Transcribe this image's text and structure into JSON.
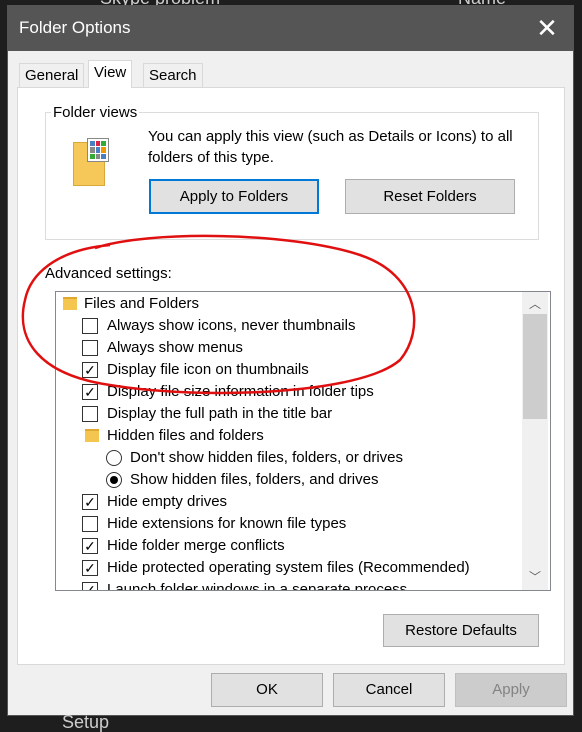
{
  "background": {
    "text1": "Skype problem",
    "text2": "Name",
    "text3": "Setup"
  },
  "dialog": {
    "title": "Folder Options",
    "close_icon": "close-icon"
  },
  "tabs": [
    {
      "label": "General"
    },
    {
      "label": "View",
      "active": true
    },
    {
      "label": "Search"
    }
  ],
  "folder_views": {
    "legend": "Folder views",
    "description": "You can apply this view (such as Details or Icons) to all folders of this type.",
    "apply_label": "Apply to Folders",
    "reset_label": "Reset Folders"
  },
  "advanced": {
    "label": "Advanced settings:",
    "items": [
      {
        "type": "folder",
        "label": "Files and Folders",
        "indent": 0
      },
      {
        "type": "checkbox",
        "label": "Always show icons, never thumbnails",
        "checked": false
      },
      {
        "type": "checkbox",
        "label": "Always show menus",
        "checked": false
      },
      {
        "type": "checkbox",
        "label": "Display file icon on thumbnails",
        "checked": true
      },
      {
        "type": "checkbox",
        "label": "Display file size information in folder tips",
        "checked": true
      },
      {
        "type": "checkbox",
        "label": "Display the full path in the title bar",
        "checked": false
      },
      {
        "type": "folder",
        "label": "Hidden files and folders",
        "indent": 1
      },
      {
        "type": "radio",
        "label": "Don't show hidden files, folders, or drives",
        "checked": false
      },
      {
        "type": "radio",
        "label": "Show hidden files, folders, and drives",
        "checked": true
      },
      {
        "type": "checkbox",
        "label": "Hide empty drives",
        "checked": true
      },
      {
        "type": "checkbox",
        "label": "Hide extensions for known file types",
        "checked": false
      },
      {
        "type": "checkbox",
        "label": "Hide folder merge conflicts",
        "checked": true
      },
      {
        "type": "checkbox",
        "label": "Hide protected operating system files (Recommended)",
        "checked": true
      },
      {
        "type": "checkbox",
        "label": "Launch folder windows in a separate process",
        "checked": true
      }
    ]
  },
  "restore_label": "Restore Defaults",
  "footer": {
    "ok": "OK",
    "cancel": "Cancel",
    "apply": "Apply"
  },
  "colors": {
    "annotation": "#e01010",
    "focus": "#0078d7",
    "titlebar": "#555555"
  }
}
